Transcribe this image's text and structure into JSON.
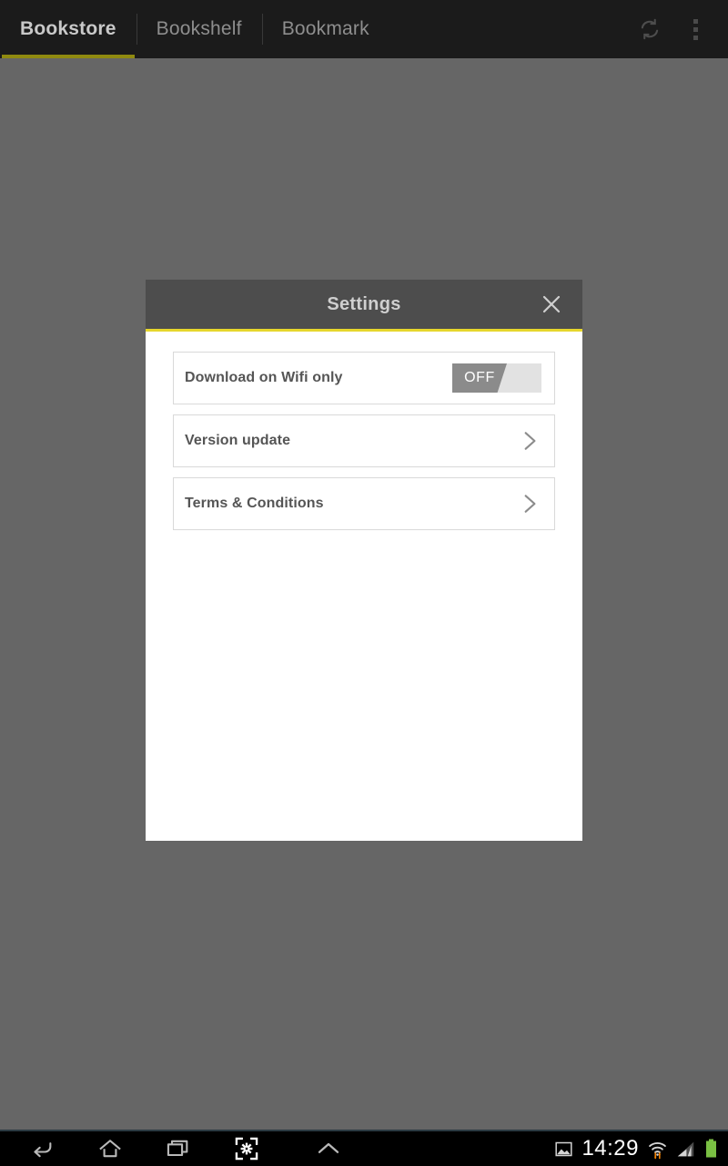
{
  "app": {
    "topbar": {
      "tabs": [
        {
          "label": "Bookstore",
          "active": true
        },
        {
          "label": "Bookshelf",
          "active": false
        },
        {
          "label": "Bookmark",
          "active": false
        }
      ],
      "actions": [
        {
          "name": "refresh-icon",
          "label": "Refresh"
        },
        {
          "name": "overflow-menu-icon",
          "label": "More options"
        }
      ],
      "active_tab_accent": "#8f8a10",
      "background": "#1b1b1b"
    },
    "scrim_color": "#666666"
  },
  "dialog": {
    "title": "Settings",
    "close_label": "Close",
    "header_background": "#4d4d4d",
    "accent": "#e6d62c",
    "rows": [
      {
        "label": "Download on Wifi only",
        "control": "toggle",
        "toggle_state": "OFF",
        "toggle_on_color": "#e2e2e2",
        "toggle_knob_color": "#8b8b8b"
      },
      {
        "label": "Version update",
        "control": "chevron"
      },
      {
        "label": "Terms & Conditions",
        "control": "chevron"
      }
    ]
  },
  "navbar": {
    "buttons": [
      {
        "name": "back-button",
        "label": "Back"
      },
      {
        "name": "home-button",
        "label": "Home"
      },
      {
        "name": "recents-button",
        "label": "Recent apps"
      },
      {
        "name": "screenshot-button",
        "label": "Screenshot"
      },
      {
        "name": "expand-button",
        "label": "Show notifications"
      }
    ],
    "status": {
      "clock": "14:29",
      "icons": [
        {
          "name": "image-icon",
          "label": "Screenshot captured"
        },
        {
          "name": "wifi-icon",
          "label": "Wi-Fi connected"
        },
        {
          "name": "signal-icon",
          "label": "Mobile signal"
        },
        {
          "name": "battery-icon",
          "label": "Battery"
        }
      ],
      "battery_color": "#7ac043",
      "wifi_arrow_color": "#f08000"
    }
  }
}
